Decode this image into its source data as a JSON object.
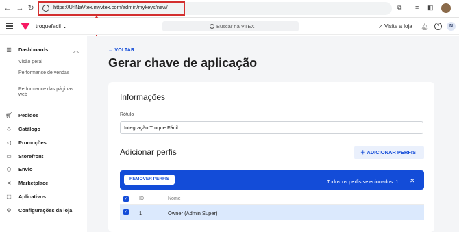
{
  "browser": {
    "url": "https://UrlNaVtex.myvtex.com/admin/mykeys/new/"
  },
  "topbar": {
    "store_name": "troquefacil",
    "search_placeholder": "Buscar na VTEX",
    "visit_store": "Visite a loja",
    "user_initial": "N"
  },
  "sidebar": {
    "dashboards": "Dashboards",
    "sub_items": [
      "Visão geral",
      "Performance de vendas",
      "Performance das páginas web"
    ],
    "items": [
      "Pedidos",
      "Catálogo",
      "Promoções",
      "Storefront",
      "Envio",
      "Marketplace",
      "Aplicativos",
      "Configurações da loja"
    ]
  },
  "main": {
    "back": "VOLTAR",
    "title": "Gerar chave de aplicação",
    "info_section": "Informações",
    "label_field": "Rótulo",
    "label_value": "Integração Troque Fácil",
    "profiles_section": "Adicionar perfis",
    "add_profiles": "ADICIONAR PERFIS",
    "remove_profiles": "REMOVER PERFIS",
    "selected_text": "Todos os perfis selecionados: 1",
    "table": {
      "headers": [
        "ID",
        "Nome"
      ],
      "rows": [
        {
          "id": "1",
          "name": "Owner (Admin Super)"
        }
      ]
    }
  },
  "colors": {
    "accent": "#134cd8",
    "brand": "#f71963",
    "annotation": "#d32f2f"
  }
}
